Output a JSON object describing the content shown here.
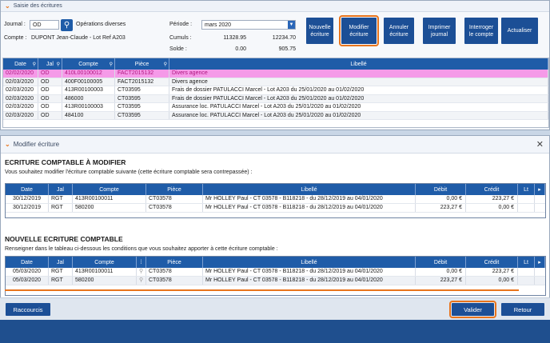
{
  "main_window": {
    "title": "Saisie des écritures",
    "journal_label": "Journal :",
    "journal_value": "OD",
    "journal_name": "Opérations diverses",
    "compte_label": "Compte :",
    "compte_value": "DUPONT Jean-Claude - Lot Ref A203",
    "periode_label": "Période :",
    "periode_value": "mars 2020",
    "cumuls_label": "Cumuls :",
    "cumuls_debit": "11328.95",
    "cumuls_credit": "12234.70",
    "solde_label": "Solde :",
    "solde_debit": "0.00",
    "solde_credit": "905.75",
    "buttons": {
      "nouvelle": "Nouvelle\nécriture",
      "modifier": "Modifier\nécriture",
      "annuler": "Annuler\nécriture",
      "imprimer": "Imprimer\njournal",
      "interroger": "Interroger\nle compte",
      "actualiser": "Actualiser"
    },
    "columns": [
      "Date",
      "Jal",
      "Compte",
      "Pièce",
      "Libellé"
    ],
    "rows": [
      {
        "date": "02/02/2020",
        "jal": "OD",
        "compte": "410L00100012",
        "piece": "FACT2015132",
        "libelle": "Divers agence"
      },
      {
        "date": "02/03/2020",
        "jal": "OD",
        "compte": "400F00100005",
        "piece": "FACT2015132",
        "libelle": "Divers agence"
      },
      {
        "date": "02/03/2020",
        "jal": "OD",
        "compte": "413R00100003",
        "piece": "CT03595",
        "libelle": "Frais de dossier PATULACCI Marcel - Lot A203 du 25/01/2020 au 01/02/2020"
      },
      {
        "date": "02/03/2020",
        "jal": "OD",
        "compte": "486000",
        "piece": "CT03595",
        "libelle": "Frais de dossier PATULACCI Marcel - Lot A203 du 25/01/2020 au 01/02/2020"
      },
      {
        "date": "02/03/2020",
        "jal": "OD",
        "compte": "413R00100003",
        "piece": "CT03595",
        "libelle": "Assurance loc. PATULACCI Marcel - Lot A203 du 25/01/2020 au 01/02/2020"
      },
      {
        "date": "02/03/2020",
        "jal": "OD",
        "compte": "484100",
        "piece": "CT03595",
        "libelle": "Assurance loc. PATULACCI Marcel - Lot A203 du 25/01/2020 au 01/02/2020"
      }
    ]
  },
  "dialog": {
    "title": "Modifier écriture",
    "close": "✕",
    "section1_title": "ECRITURE COMPTABLE À MODIFIER",
    "section1_sub": "Vous souhaitez modifier l'écriture comptable suivante (cette écriture comptable sera contrepassée) :",
    "section2_title": "NOUVELLE ECRITURE COMPTABLE",
    "section2_sub": "Renseigner dans le tableau ci-dessous les conditions que vous souhaitez apporter à cette écriture comptable :",
    "columns": [
      "Date",
      "Jal",
      "Compte",
      "Pièce",
      "Libellé",
      "Débit",
      "Crédit",
      "Lt"
    ],
    "old_rows": [
      {
        "date": "30/12/2019",
        "jal": "RGT",
        "compte": "413R00100011",
        "piece": "CT03578",
        "libelle": "Mr HOLLEY Paul - CT 03578 - B118218 -  du 28/12/2019 au 04/01/2020",
        "debit": "0,00 €",
        "credit": "223,27 €"
      },
      {
        "date": "30/12/2019",
        "jal": "RGT",
        "compte": "580200",
        "piece": "CT03578",
        "libelle": "Mr HOLLEY Paul - CT 03578 - B118218 -  du 28/12/2019 au 04/01/2020",
        "debit": "223,27 €",
        "credit": "0,00 €"
      }
    ],
    "new_rows": [
      {
        "date": "05/03/2020",
        "jal": "RGT",
        "compte": "413R00100011",
        "piece": "CT03578",
        "libelle": "Mr HOLLEY Paul - CT 03578 - B118218 -  du 28/12/2019 au 04/01/2020",
        "debit": "0,00 €",
        "credit": "223,27 €"
      },
      {
        "date": "05/03/2020",
        "jal": "RGT",
        "compte": "580200",
        "piece": "CT03578",
        "libelle": "Mr HOLLEY Paul - CT 03578 - B118218 -  du 28/12/2019 au 04/01/2020",
        "debit": "223,27 €",
        "credit": "0,00 €"
      }
    ],
    "raccourcis_label": "Raccourcis",
    "valider_label": "Valider",
    "retour_label": "Retour"
  },
  "colors": {
    "accent": "#e8741c",
    "primary": "#1f5ca8",
    "selected_row": "#f59ae8"
  }
}
